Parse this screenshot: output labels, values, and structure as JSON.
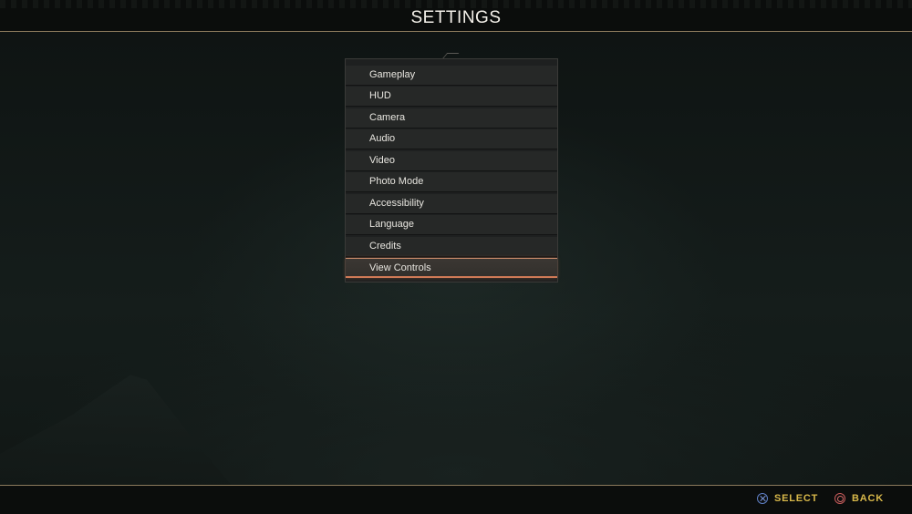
{
  "header": {
    "title": "SETTINGS"
  },
  "menu": {
    "items": [
      {
        "label": "Gameplay",
        "selected": false
      },
      {
        "label": "HUD",
        "selected": false
      },
      {
        "label": "Camera",
        "selected": false
      },
      {
        "label": "Audio",
        "selected": false
      },
      {
        "label": "Video",
        "selected": false
      },
      {
        "label": "Photo Mode",
        "selected": false
      },
      {
        "label": "Accessibility",
        "selected": false
      },
      {
        "label": "Language",
        "selected": false
      },
      {
        "label": "Credits",
        "selected": false
      },
      {
        "label": "View Controls",
        "selected": true
      }
    ]
  },
  "footer": {
    "select": {
      "label": "SELECT",
      "icon": "cross-button-icon"
    },
    "back": {
      "label": "BACK",
      "icon": "circle-button-icon"
    }
  },
  "colors": {
    "accent_gold": "#d8b84a",
    "selection_orange": "#d07a56",
    "divider": "#8b7a5c"
  }
}
